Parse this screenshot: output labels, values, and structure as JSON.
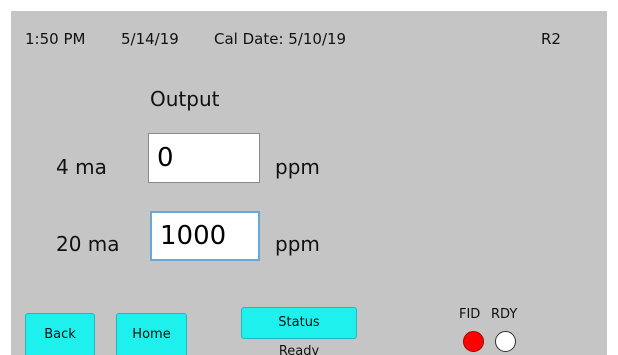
{
  "status_bar": {
    "time": "1:50 PM",
    "date": "5/14/19",
    "cal_date": "Cal Date: 5/10/19",
    "revision": "R2"
  },
  "output": {
    "title": "Output",
    "rows": [
      {
        "label": "4 ma",
        "value": "0",
        "unit": "ppm"
      },
      {
        "label": "20 ma",
        "value": "1000",
        "unit": "ppm"
      }
    ]
  },
  "buttons": {
    "back": "Back",
    "home": "Home",
    "status": "Status"
  },
  "status_text": "Ready",
  "indicators": {
    "fid": {
      "label": "FID",
      "state": "on",
      "color": "#ff0000"
    },
    "rdy": {
      "label": "RDY",
      "state": "off",
      "color": "#ffffff"
    }
  },
  "colors": {
    "screen_background": "#c5c5c5",
    "button": "#1ef0ee",
    "focused_field_border": "#6aa6d8"
  }
}
